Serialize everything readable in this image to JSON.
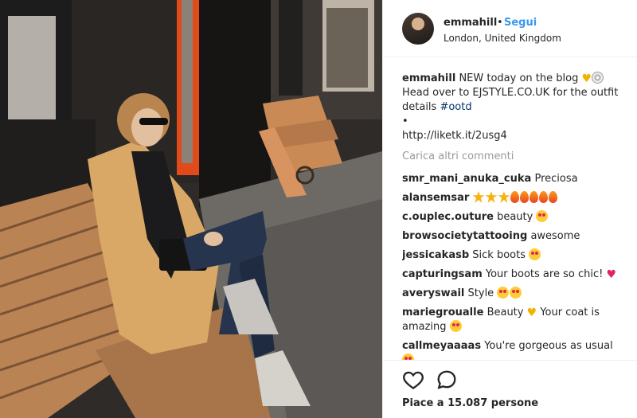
{
  "header": {
    "username": "emmahill",
    "separator": "•",
    "follow_label": "Segui",
    "location": "London, United Kingdom"
  },
  "caption": {
    "username": "emmahill",
    "line1": "NEW today on the blog",
    "line2": "Head over to EJSTYLE.CO.UK for the outfit details",
    "hashtag": "#ootd",
    "bullet": "•",
    "link": "http://liketk.it/2usg4"
  },
  "load_more_label": "Carica altri commenti",
  "comments": [
    {
      "user": "smr_mani_anuka_cuka",
      "text": "Preciosa"
    },
    {
      "user": "alansemsar",
      "text": ""
    },
    {
      "user": "c.ouplec.outure",
      "text": "beauty"
    },
    {
      "user": "browsocietytattooing",
      "text": "awesome"
    },
    {
      "user": "jessicakasb",
      "text": "Sick boots"
    },
    {
      "user": "capturingsam",
      "text": "Your boots are so chic!"
    },
    {
      "user": "averyswail",
      "text": "Style"
    },
    {
      "user": "mariegroualle",
      "text": "Beauty",
      "text2": "Your coat is amazing"
    },
    {
      "user": "callmeyaaaas",
      "text": "You're gorgeous as usual"
    }
  ],
  "likes_label": "Piace a 15.087 persone",
  "icons": {
    "like": "heart-outline-icon",
    "comment": "speech-bubble-icon"
  },
  "colors": {
    "link_blue": "#3897f0",
    "hashtag": "#003569",
    "muted": "#999999",
    "text": "#262626"
  }
}
